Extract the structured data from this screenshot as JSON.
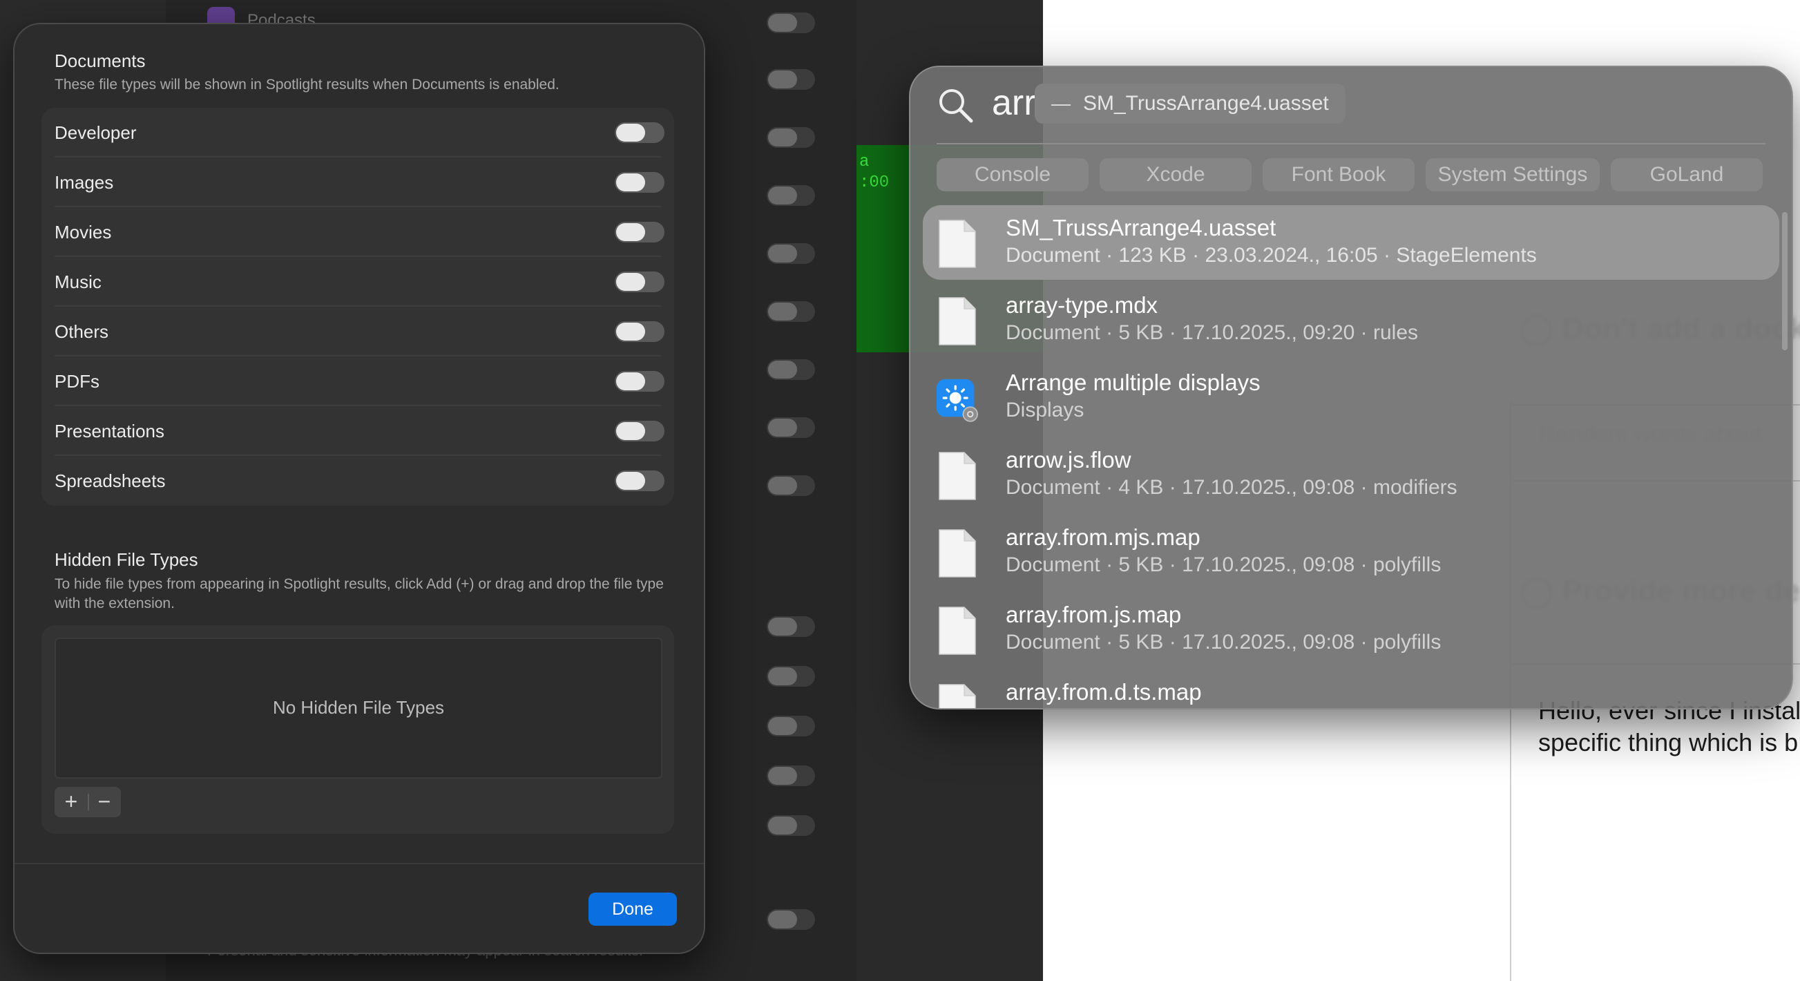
{
  "background": {
    "sidebar_item": "Podcasts",
    "footer_text": "Personal and sensitive information may appear in search results.",
    "right_text_lines": [
      "Hello, ever since I install",
      "specific thing which is b"
    ]
  },
  "dialog": {
    "title": "Documents",
    "subtitle": "These file types will be shown in Spotlight results when Documents is enabled.",
    "types": [
      {
        "label": "Developer",
        "enabled": false
      },
      {
        "label": "Images",
        "enabled": false
      },
      {
        "label": "Movies",
        "enabled": false
      },
      {
        "label": "Music",
        "enabled": false
      },
      {
        "label": "Others",
        "enabled": false
      },
      {
        "label": "PDFs",
        "enabled": false
      },
      {
        "label": "Presentations",
        "enabled": false
      },
      {
        "label": "Spreadsheets",
        "enabled": false
      }
    ],
    "hidden_title": "Hidden File Types",
    "hidden_subtitle": "To hide file types from appearing in Spotlight results, click Add (+) or drag and drop the file type with the extension.",
    "hidden_empty": "No Hidden File Types",
    "add_label": "+",
    "remove_label": "−",
    "done_label": "Done"
  },
  "spotlight": {
    "query": "arr",
    "suggestion_dash": "—",
    "suggestion": "SM_TrussArrange4.uasset",
    "chips": [
      "Console",
      "Xcode",
      "Font Book",
      "System Settings",
      "GoLand"
    ],
    "results": [
      {
        "title": "SM_TrussArrange4.uasset",
        "subtitle": "Document · 123 KB · 23.03.2024., 16:05 · StageElements",
        "icon": "document-icon",
        "selected": true
      },
      {
        "title": "array-type.mdx",
        "subtitle": "Document · 5 KB · 17.10.2025., 09:20 · rules",
        "icon": "document-icon",
        "selected": false
      },
      {
        "title": "Arrange multiple displays",
        "subtitle": "Displays",
        "icon": "displays-settings-icon",
        "selected": false
      },
      {
        "title": "arrow.js.flow",
        "subtitle": "Document · 4 KB · 17.10.2025., 09:08 · modifiers",
        "icon": "document-icon",
        "selected": false
      },
      {
        "title": "array.from.mjs.map",
        "subtitle": "Document · 5 KB · 17.10.2025., 09:08 · polyfills",
        "icon": "document-icon",
        "selected": false
      },
      {
        "title": "array.from.js.map",
        "subtitle": "Document · 5 KB · 17.10.2025., 09:08 · polyfills",
        "icon": "document-icon",
        "selected": false
      },
      {
        "title": "array.from.d.ts.map",
        "subtitle": "",
        "icon": "document-icon",
        "selected": false
      }
    ]
  }
}
